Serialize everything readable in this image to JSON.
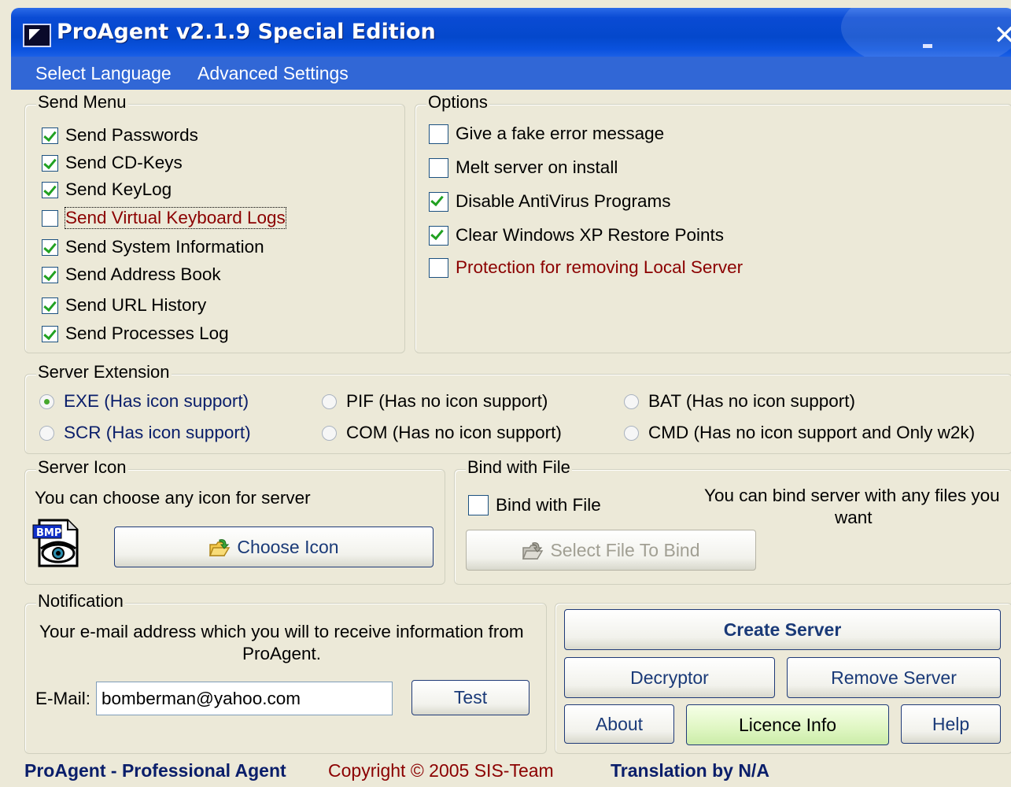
{
  "window": {
    "title": "ProAgent v2.1.9 Special Edition",
    "minimize_glyph": "–",
    "close_glyph": "✕"
  },
  "menu": {
    "items": [
      "Select Language",
      "Advanced Settings"
    ]
  },
  "send_menu": {
    "legend": "Send Menu",
    "items": [
      {
        "label": "Send Passwords",
        "checked": true
      },
      {
        "label": "Send CD-Keys",
        "checked": true
      },
      {
        "label": "Send KeyLog",
        "checked": true
      },
      {
        "label": "Send Virtual Keyboard Logs",
        "checked": false
      },
      {
        "label": "Send System Information",
        "checked": true
      },
      {
        "label": "Send Address Book",
        "checked": true
      },
      {
        "label": "Send URL History",
        "checked": true
      },
      {
        "label": "Send Processes Log",
        "checked": true
      }
    ]
  },
  "options": {
    "legend": "Options",
    "items": [
      {
        "label": "Give a fake error message",
        "checked": false
      },
      {
        "label": "Melt server on install",
        "checked": false
      },
      {
        "label": "Disable AntiVirus Programs",
        "checked": true
      },
      {
        "label": "Clear Windows XP Restore Points",
        "checked": true
      },
      {
        "label": "Protection for removing Local Server",
        "checked": false
      }
    ]
  },
  "server_extension": {
    "legend": "Server Extension",
    "selected": "EXE (Has icon support)",
    "items": [
      "EXE (Has icon support)",
      "SCR (Has icon support)",
      "PIF (Has no icon support)",
      "COM (Has no icon support)",
      "BAT (Has no icon support)",
      "CMD (Has no icon support and Only w2k)"
    ]
  },
  "server_icon": {
    "legend": "Server Icon",
    "description": "You can choose any icon for server",
    "icon_text": "BMP",
    "button": "Choose Icon"
  },
  "bind": {
    "legend": "Bind with File",
    "checkbox_label": "Bind with File",
    "checked": false,
    "description_line1": "You can bind server with any files you",
    "description_line2": "want",
    "button": "Select File To Bind"
  },
  "notification": {
    "legend": "Notification",
    "description_line1": "Your e-mail address which you will to receive information from",
    "description_line2": "ProAgent.",
    "email_label": "E-Mail:",
    "email_value": "bomberman@yahoo.com",
    "test_button": "Test"
  },
  "actions": {
    "create": "Create Server",
    "decryptor": "Decryptor",
    "remove": "Remove Server",
    "about": "About",
    "licence": "Licence Info",
    "help": "Help"
  },
  "footer": {
    "product": "ProAgent - Professional Agent",
    "copyright": "Copyright © 2005 SIS-Team",
    "translation": "Translation by N/A"
  },
  "colors": {
    "titlebar": "#0a4bd4",
    "menubar": "#3167d6",
    "panel": "#ece9d8",
    "warning_text": "#8b0000",
    "footer_blue": "#0a1e6a",
    "check": "#21a121"
  }
}
